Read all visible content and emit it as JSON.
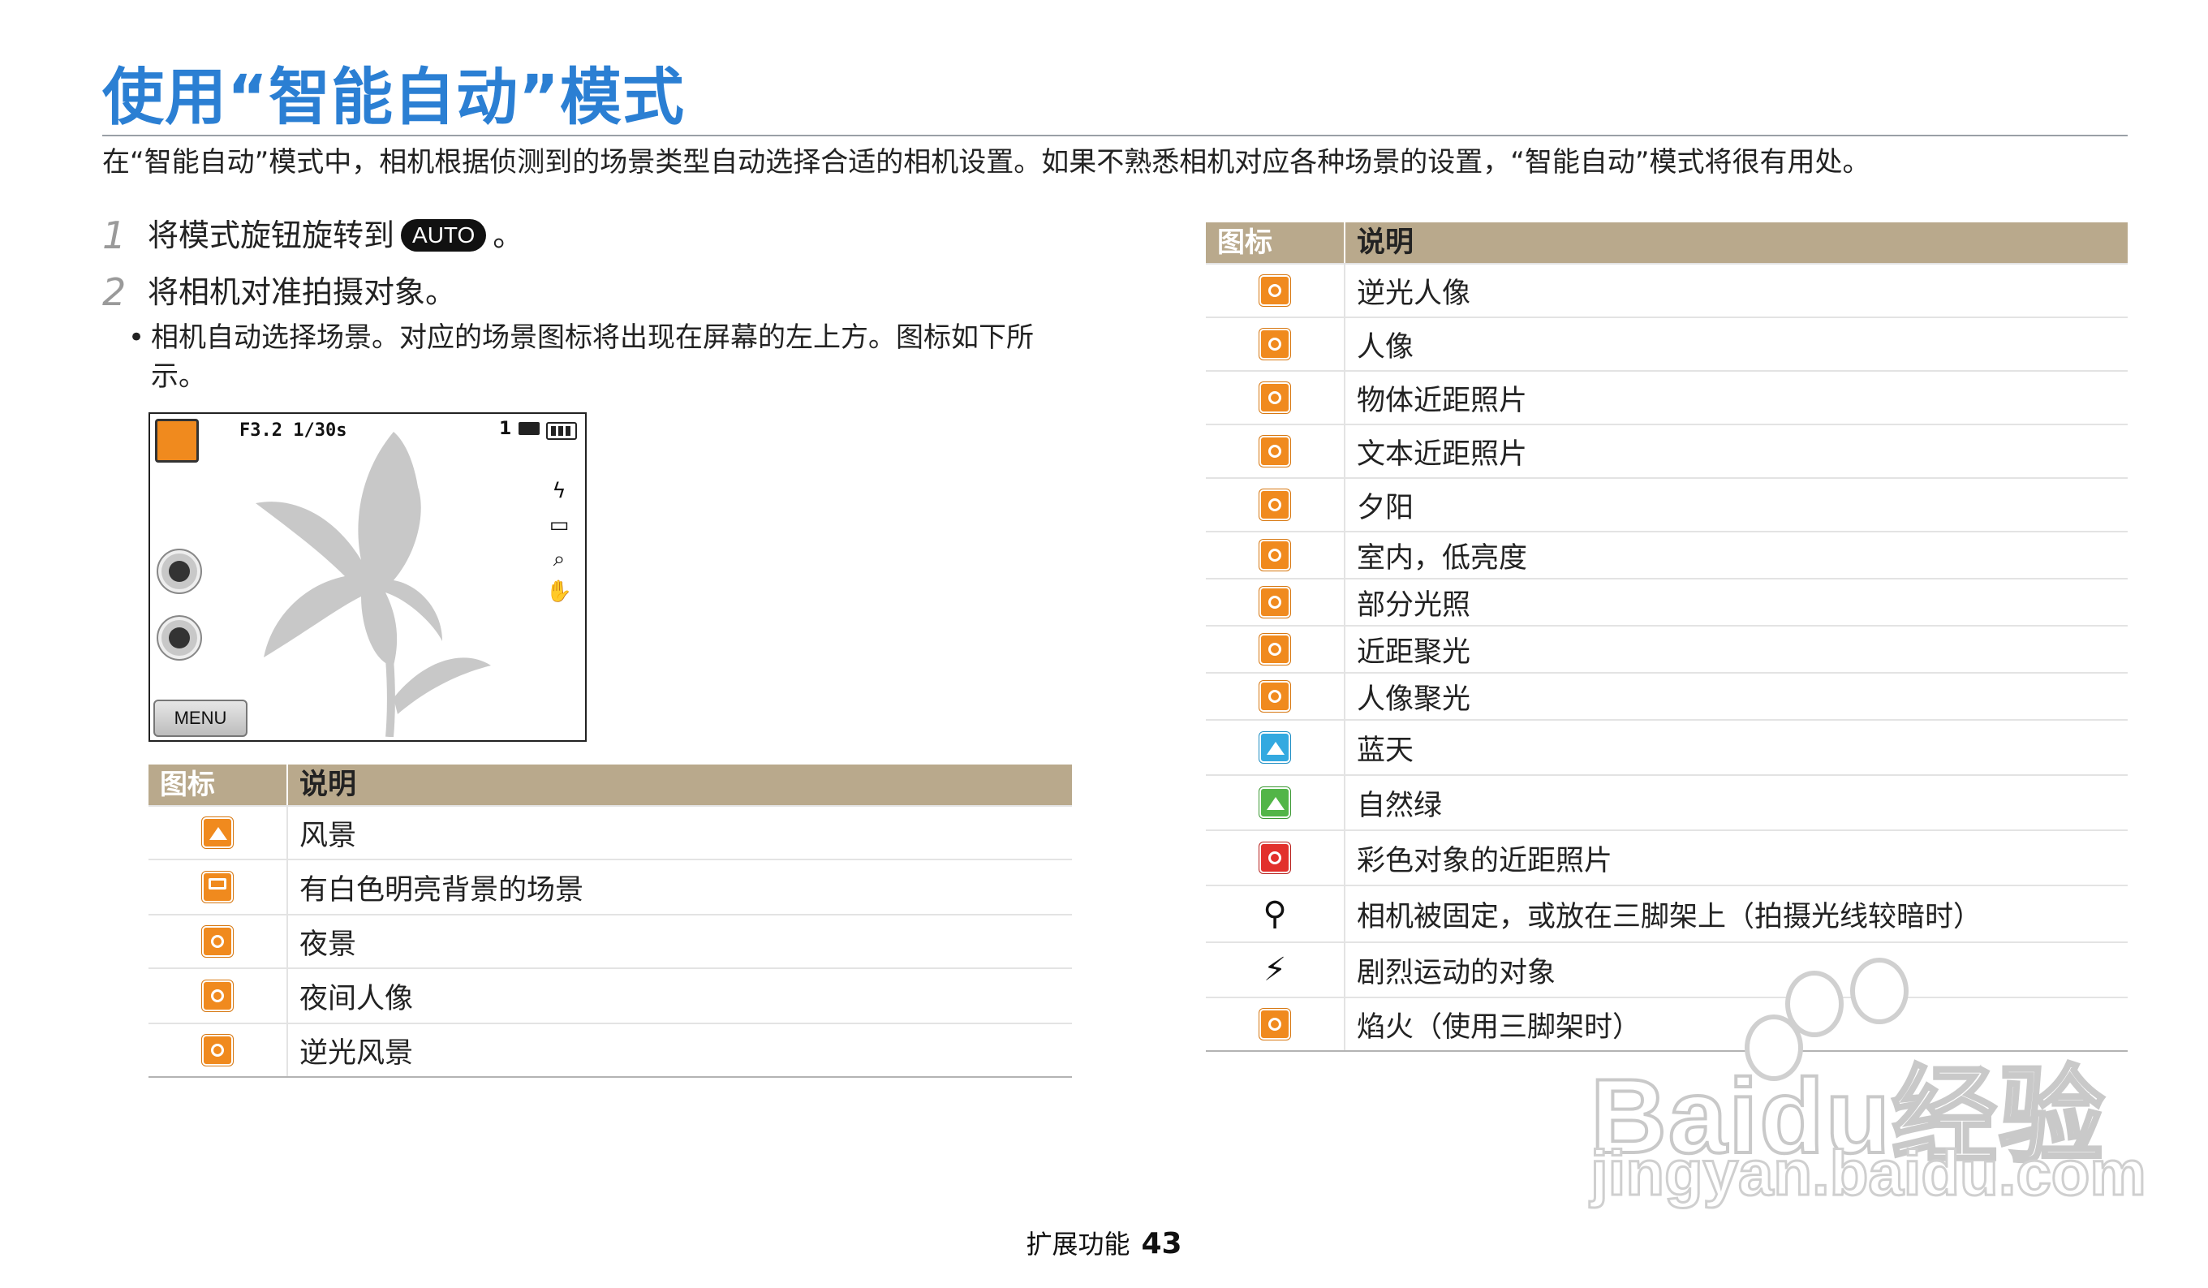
{
  "title": "使用“智能自动”模式",
  "intro": "在“智能自动”模式中，相机根据侦测到的场景类型自动选择合适的相机设置。如果不熟悉相机对应各种场景的设置，“智能自动”模式将很有用处。",
  "steps": [
    {
      "num": "1",
      "text_before": "将模式旋钮旋转到",
      "badge": "AUTO",
      "text_after": "。"
    },
    {
      "num": "2",
      "text_before": "将相机对准拍摄对象。"
    }
  ],
  "bullet": "相机自动选择场景。对应的场景图标将出现在屏幕的左上方。图标如下所示。",
  "preview": {
    "exposure": "F3.2 1/30s",
    "shots": "1",
    "menu_label": "MENU",
    "right_icons": [
      "flash-auto-icon",
      "size-14m-icon",
      "smart-zoom-icon",
      "ois-icon"
    ],
    "left_icons": [
      "face-detect-off-icon",
      "smart-filter-icon"
    ]
  },
  "table_headers": {
    "icon": "图标",
    "desc": "说明"
  },
  "left_table": [
    {
      "icon": "landscape-icon",
      "desc": "风景"
    },
    {
      "icon": "white-scene-icon",
      "desc": "有白色明亮背景的场景"
    },
    {
      "icon": "night-icon",
      "desc": "夜景"
    },
    {
      "icon": "night-portrait-icon",
      "desc": "夜间人像"
    },
    {
      "icon": "backlit-landscape-icon",
      "desc": "逆光风景"
    }
  ],
  "right_table": [
    {
      "icon": "backlit-portrait-icon",
      "desc": "逆光人像"
    },
    {
      "icon": "portrait-icon",
      "desc": "人像"
    },
    {
      "icon": "macro-icon",
      "desc": "物体近距照片"
    },
    {
      "icon": "macro-text-icon",
      "desc": "文本近距照片"
    },
    {
      "icon": "sunset-icon",
      "desc": "夕阳"
    },
    {
      "icon": "low-light-icon",
      "desc": "室内，低亮度"
    },
    {
      "icon": "spotlight-icon",
      "desc": "部分光照"
    },
    {
      "icon": "macro-spotlight-icon",
      "desc": "近距聚光"
    },
    {
      "icon": "portrait-spotlight-icon",
      "desc": "人像聚光"
    },
    {
      "icon": "blue-sky-icon",
      "desc": "蓝天"
    },
    {
      "icon": "natural-green-icon",
      "desc": "自然绿"
    },
    {
      "icon": "macro-color-icon",
      "desc": "彩色对象的近距照片"
    },
    {
      "icon": "tripod-icon",
      "desc": "相机被固定，或放在三脚架上（拍摄光线较暗时）"
    },
    {
      "icon": "action-icon",
      "desc": "剧烈运动的对象"
    },
    {
      "icon": "fireworks-icon",
      "desc": "焰火（使用三脚架时）"
    }
  ],
  "footer": {
    "section": "扩展功能",
    "page": "43"
  },
  "watermark": {
    "brand": "Bai",
    "suffix": "du经验",
    "url": "jingyan.baidu.com"
  },
  "colors": {
    "title": "#2b7fd3",
    "table_header": "#b9a98c",
    "scene_orange": "#f08a1e",
    "sky_blue": "#33a9e0",
    "green": "#52b548"
  }
}
